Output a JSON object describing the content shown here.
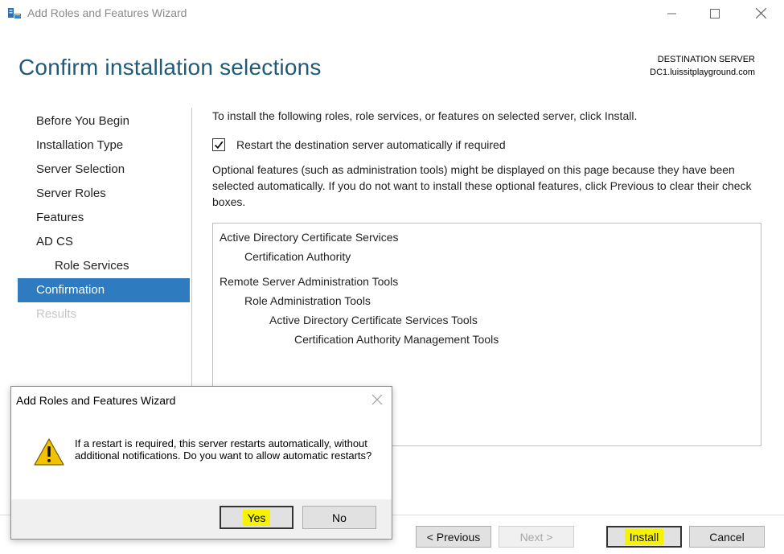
{
  "window": {
    "title": "Add Roles and Features Wizard",
    "controls": [
      "minimize-icon",
      "maximize-icon",
      "close-icon"
    ]
  },
  "header": {
    "page_title": "Confirm installation selections",
    "destination_label": "DESTINATION SERVER",
    "destination_server": "DC1.luissitplayground.com"
  },
  "nav": {
    "items": [
      {
        "label": "Before You Begin",
        "state": "normal"
      },
      {
        "label": "Installation Type",
        "state": "normal"
      },
      {
        "label": "Server Selection",
        "state": "normal"
      },
      {
        "label": "Server Roles",
        "state": "normal"
      },
      {
        "label": "Features",
        "state": "normal"
      },
      {
        "label": "AD CS",
        "state": "normal"
      },
      {
        "label": "Role Services",
        "state": "indented"
      },
      {
        "label": "Confirmation",
        "state": "active"
      },
      {
        "label": "Results",
        "state": "disabled"
      }
    ]
  },
  "main": {
    "intro": "To install the following roles, role services, or features on selected server, click Install.",
    "restart_checkbox": {
      "label": "Restart the destination server automatically if required",
      "checked": true
    },
    "optional_note": "Optional features (such as administration tools) might be displayed on this page because they have been selected automatically. If you do not want to install these optional features, click Previous to clear their check boxes.",
    "selections": [
      {
        "label": "Active Directory Certificate Services",
        "level": 0
      },
      {
        "label": "Certification Authority",
        "level": 1
      },
      {
        "label": "Remote Server Administration Tools",
        "level": 0
      },
      {
        "label": "Role Administration Tools",
        "level": 1
      },
      {
        "label": "Active Directory Certificate Services Tools",
        "level": 2
      },
      {
        "label": "Certification Authority Management Tools",
        "level": 3
      }
    ]
  },
  "footer": {
    "previous_label": "< Previous",
    "next_label": "Next >",
    "install_label": "Install",
    "cancel_label": "Cancel"
  },
  "dialog": {
    "title": "Add Roles and Features Wizard",
    "icon": "warning-icon",
    "message": "If a restart is required, this server restarts automatically, without additional notifications. Do you want to allow automatic restarts?",
    "yes_label": "Yes",
    "no_label": "No"
  },
  "colors": {
    "title_blue": "#1e5a7a",
    "active_nav": "#2e7bbf",
    "highlight": "#f7f200",
    "warning": "#f2c200"
  }
}
